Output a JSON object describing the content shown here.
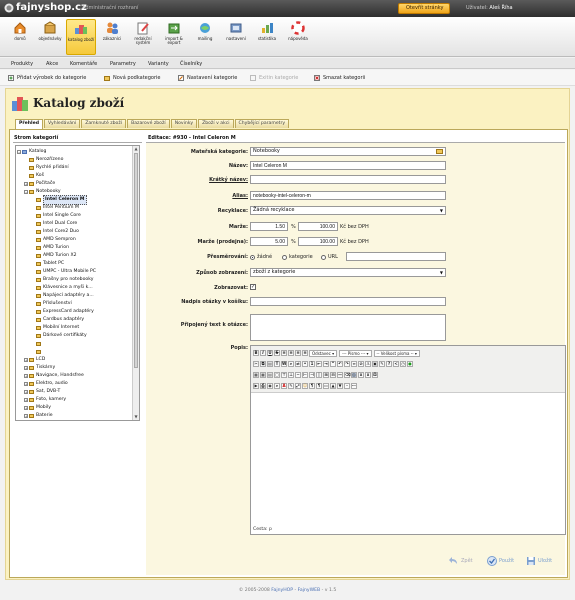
{
  "app": {
    "logo_text": "fajnyshop.cz",
    "admin_title": "Administrační rozhraní",
    "open_shop_label": "Otevřít stránky",
    "user_label": "Uživatel:",
    "user_name": "Aleš Říha",
    "logout_label": ""
  },
  "iconbar": [
    {
      "label": "domů",
      "icon": "home-icon"
    },
    {
      "label": "objednávky",
      "icon": "box-icon"
    },
    {
      "label": "katalog zboží",
      "icon": "catalog-icon"
    },
    {
      "label": "zákazníci",
      "icon": "customers-icon"
    },
    {
      "label": "redakční systém",
      "icon": "cms-icon"
    },
    {
      "label": "import & export",
      "icon": "import-export-icon"
    },
    {
      "label": "mailing",
      "icon": "mailing-icon"
    },
    {
      "label": "nastavení",
      "icon": "settings-icon"
    },
    {
      "label": "statistika",
      "icon": "statistics-icon"
    },
    {
      "label": "nápověda",
      "icon": "help-icon"
    }
  ],
  "menu": [
    "Produkty",
    "Akce",
    "Komentáře",
    "Parametry",
    "Varianty",
    "Číselníky"
  ],
  "actions": [
    {
      "label": "Přidat výrobek do kategorie",
      "disabled": false
    },
    {
      "label": "Nová podkategorie",
      "disabled": false
    },
    {
      "label": "Nastavení kategorie",
      "disabled": false
    },
    {
      "label": "Exitin kategorie",
      "disabled": true
    },
    {
      "label": "Smazat kategorii",
      "disabled": false
    }
  ],
  "page_title": "Katalog zboží",
  "tabs": [
    "Přehled",
    "Vyhledávání",
    "Zamknuté zboží",
    "Bazarové zboží",
    "Novinky",
    "Zboží v akci",
    "Chybějící parametry"
  ],
  "tree": {
    "title": "Strom kategorií",
    "nodes": [
      {
        "label": "Katalog",
        "level": 0,
        "toggle": "−"
      },
      {
        "label": "Nerozřízeno",
        "level": 1,
        "toggle": ""
      },
      {
        "label": "Rychlé přidání",
        "level": 1,
        "toggle": ""
      },
      {
        "label": "Koš",
        "level": 1,
        "toggle": ""
      },
      {
        "label": "Počítače",
        "level": 1,
        "toggle": "+"
      },
      {
        "label": "Notebooky",
        "level": 1,
        "toggle": "−"
      },
      {
        "label": "Intel Celeron M",
        "level": 2,
        "toggle": "",
        "selected": true
      },
      {
        "label": "Intel Pentium M",
        "level": 2,
        "toggle": ""
      },
      {
        "label": "Intel Single Core",
        "level": 2,
        "toggle": ""
      },
      {
        "label": "Intel Dual Core",
        "level": 2,
        "toggle": ""
      },
      {
        "label": "Intel Core2 Duo",
        "level": 2,
        "toggle": ""
      },
      {
        "label": "AMD Sempron",
        "level": 2,
        "toggle": ""
      },
      {
        "label": "AMD Turion",
        "level": 2,
        "toggle": ""
      },
      {
        "label": "AMD Turion X2",
        "level": 2,
        "toggle": ""
      },
      {
        "label": "Tablet PC",
        "level": 2,
        "toggle": ""
      },
      {
        "label": "UMPC - Ultra Mobile PC",
        "level": 2,
        "toggle": ""
      },
      {
        "label": "Brašny pro notebooky",
        "level": 2,
        "toggle": ""
      },
      {
        "label": "Klávesnice a myši k...",
        "level": 2,
        "toggle": ""
      },
      {
        "label": "Napájecí adaptéry a...",
        "level": 2,
        "toggle": ""
      },
      {
        "label": "Příslušenství",
        "level": 2,
        "toggle": ""
      },
      {
        "label": "ExpressCard adaptéry",
        "level": 2,
        "toggle": ""
      },
      {
        "label": "Cardbus adaptéry",
        "level": 2,
        "toggle": ""
      },
      {
        "label": "Mobilní Internet",
        "level": 2,
        "toggle": ""
      },
      {
        "label": "Dárkové certifikáty",
        "level": 2,
        "toggle": ""
      },
      {
        "label": "",
        "level": 2,
        "toggle": ""
      },
      {
        "label": "",
        "level": 2,
        "toggle": ""
      },
      {
        "label": "LCD",
        "level": 1,
        "toggle": "+"
      },
      {
        "label": "Tiskárny",
        "level": 1,
        "toggle": "+"
      },
      {
        "label": "Navigace, Handsfree",
        "level": 1,
        "toggle": "+"
      },
      {
        "label": "Elektro, audio",
        "level": 1,
        "toggle": "+"
      },
      {
        "label": "Sat, DVB-T",
        "level": 1,
        "toggle": "+"
      },
      {
        "label": "Foto, kamery",
        "level": 1,
        "toggle": "+"
      },
      {
        "label": "Mobily",
        "level": 1,
        "toggle": "+"
      },
      {
        "label": "Baterie",
        "level": 1,
        "toggle": "+"
      }
    ]
  },
  "form": {
    "header": "Editace: #930 - Intel Celeron M",
    "labels": {
      "parent": "Mateřská kategorie:",
      "name": "Název:",
      "short_name": "Krátký název:",
      "alias": "Alias:",
      "recyclation": "Recyklace:",
      "margin": "Marže:",
      "margin_sales": "Marže (prodejna):",
      "redirect": "Přesměrování:",
      "display_mode": "Způsob zobrazení:",
      "visible": "Zobrazovat:",
      "cart_question": "Nadpis otázky v košíku:",
      "question_text": "Připojený text k otázce:",
      "description": "Popis:"
    },
    "values": {
      "parent": "Notebooky",
      "name": "Intel Celeron M",
      "short_name": "",
      "alias": "notebooky-intel-celeron-m",
      "recyclation": "Žádná recyklace",
      "margin_pct": "1.50",
      "margin_amount": "100.00",
      "margin_sales_pct": "5.00",
      "margin_sales_amount": "100.00",
      "pct_unit": "%",
      "amount_unit": "Kč bez DPH",
      "redirect_options": [
        "žádné",
        "kategorie",
        "URL"
      ],
      "redirect_selected": "žádné",
      "display_mode": "zboží z kategorie",
      "visible_checked": true,
      "cart_question": "",
      "question_text": ""
    },
    "editor": {
      "format_select": "Odstavec",
      "font_select": "--- Písmo ---",
      "size_select": "-- Velikost písma --",
      "status": "Cesta: p"
    },
    "buttons": {
      "back": "Zpět",
      "apply": "Použít",
      "save": "Uložit"
    }
  },
  "footer": {
    "copyright": "© 2005-2008",
    "link1": "FajnyHOP",
    "separator": " - ",
    "link2": "FajnyWEB",
    "version": " - v 1.5"
  },
  "colors": {
    "accent_yellow": "#fbf2c2",
    "button_orange": "#f0a51a",
    "link_blue": "#4a6fb3"
  }
}
